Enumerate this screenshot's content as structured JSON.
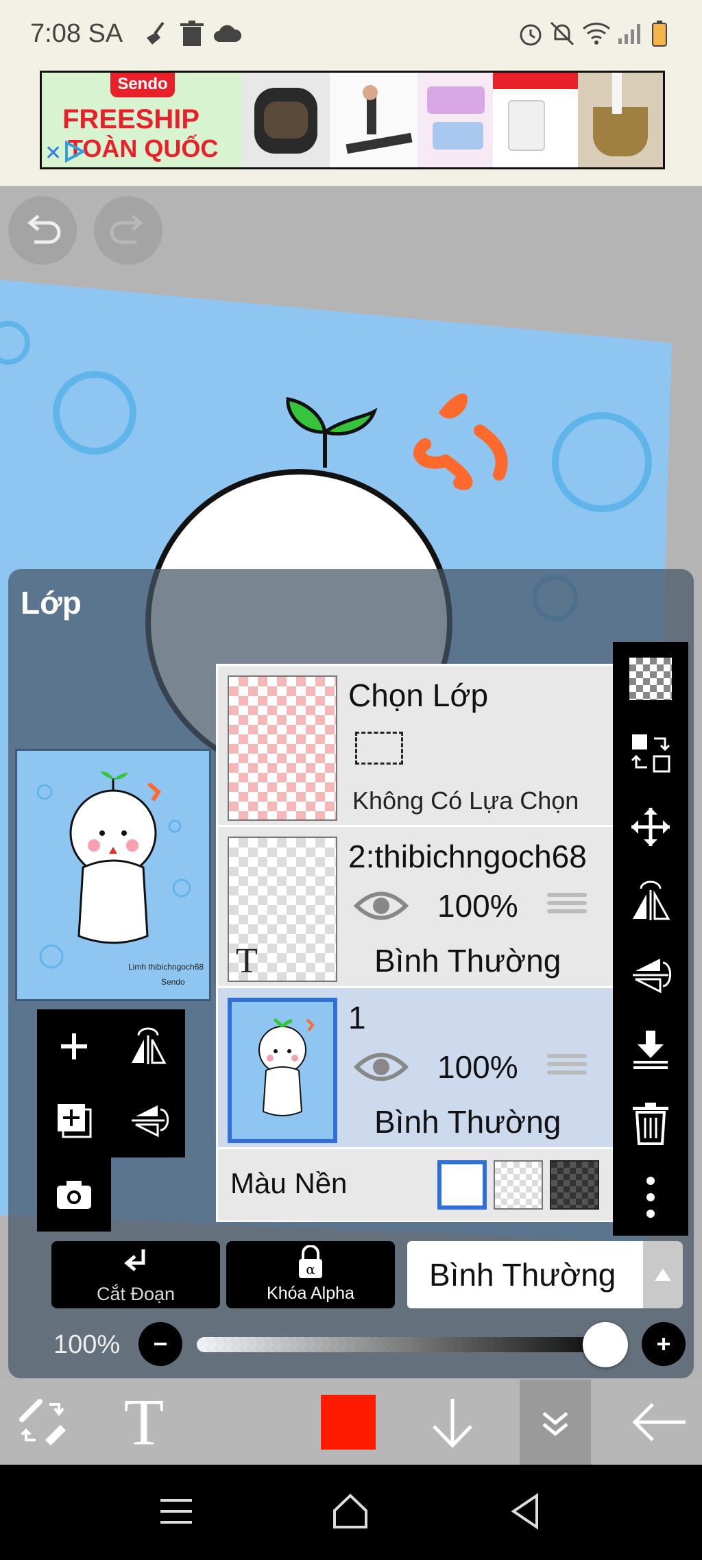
{
  "status_bar": {
    "time": "7:08 SA",
    "left_icons": [
      "broom-icon",
      "trash-icon",
      "cloud-icon"
    ],
    "right_icons": [
      "alarm-icon",
      "mute-icon",
      "wifi-icon",
      "signal-icon",
      "battery-icon"
    ]
  },
  "ad": {
    "brand": "Sendo",
    "headline": "FREESHIP",
    "subline": "TOÀN QUỐC"
  },
  "canvas": {
    "undo_icon": "undo-icon",
    "redo_icon": "redo-icon"
  },
  "layer_panel": {
    "title": "Lớp",
    "selection_layer": {
      "title": "Chọn Lớp",
      "status": "Không Có Lựa Chọn"
    },
    "layers": [
      {
        "name": "2:thibichngoch68",
        "opacity": "100%",
        "blend": "Bình Thường",
        "selected": false
      },
      {
        "name": "1",
        "opacity": "100%",
        "blend": "Bình Thường",
        "selected": true
      }
    ],
    "background_color_label": "Màu Nền",
    "thumb_text": [
      "Limh thibichngoch68",
      "Sendo"
    ],
    "clip_label": "Cắt Đoạn",
    "alpha_lock_label": "Khóa Alpha",
    "blend_mode": "Bình Thường",
    "opacity_label": "100%",
    "opacity_value": 1.0
  },
  "colors": {
    "accent_blue": "#2f6fd6",
    "current_color": "#ff1a00",
    "canvas_blue": "#8fc6f1",
    "selected_row": "#cdd9ec"
  },
  "toolbar": {
    "icons": [
      "brush-eraser-toggle-icon",
      "text-tool-icon",
      "color-swatch",
      "arrow-down-icon",
      "double-chevron-icon",
      "back-arrow-icon"
    ]
  },
  "navbar": {
    "icons": [
      "recent-apps-icon",
      "home-icon",
      "back-icon"
    ]
  }
}
